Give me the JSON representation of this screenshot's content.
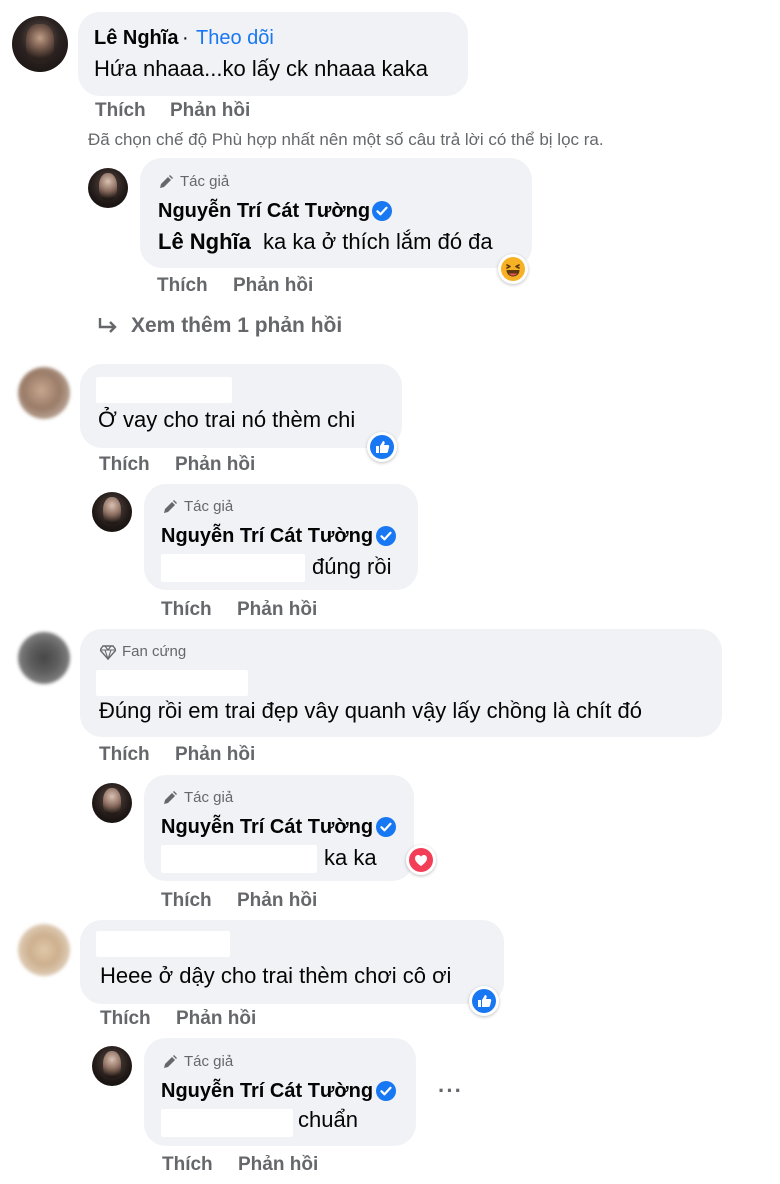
{
  "comments": [
    {
      "author": "Lê Nghĩa",
      "follow": "Theo dõi",
      "follow_sep": "·",
      "text": "Hứa nhaaa...ko lấy ck nhaaa kaka",
      "like": "Thích",
      "reply": "Phản hồi"
    }
  ],
  "filter_note": "Đã chọn chế độ Phù hợp nhất nên một số câu trả lời có thể bị lọc ra.",
  "author_badge": "Tác giả",
  "fan_badge": "Fan cứng",
  "author_name": "Nguyễn Trí Cát Tường",
  "reply1": {
    "mention": "Lê Nghĩa",
    "text": "ka ka ở thích lắm đó đa",
    "reaction": "haha-icon"
  },
  "view_more": "Xem thêm 1 phản hồi",
  "comment2": {
    "text": "Ở vay cho trai nó thèm chi",
    "reaction": "like-icon"
  },
  "reply2": {
    "text": "đúng rồi"
  },
  "comment3": {
    "text": "Đúng rồi em trai đẹp vây quanh vậy lấy chồng là chít đó"
  },
  "reply3": {
    "text": "ka ka",
    "reaction": "love-icon"
  },
  "comment4": {
    "text": "Heee ở dậy cho trai thèm chơi cô ơi",
    "reaction": "like-icon"
  },
  "reply4": {
    "text": "chuẩn"
  },
  "actions": {
    "like": "Thích",
    "reply": "Phản hồi"
  },
  "more_options": "···",
  "colors": {
    "link": "#1877f2",
    "bubble": "#f0f2f5",
    "muted": "#65676b",
    "love": "#f33e58",
    "haha": "#f7b125"
  }
}
